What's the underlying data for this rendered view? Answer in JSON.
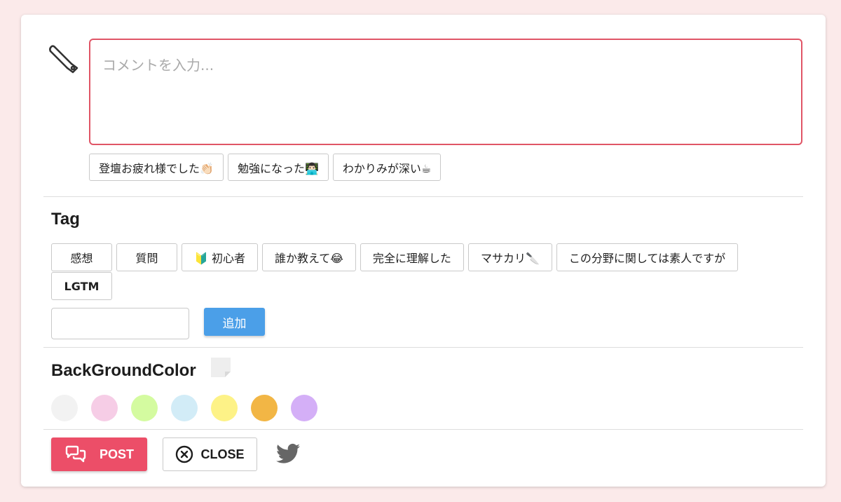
{
  "comment": {
    "placeholder": "コメントを入力..."
  },
  "quick_replies": [
    {
      "label": "登壇お疲れ様でした👏🏻"
    },
    {
      "label": "勉強になった👨🏻‍💻"
    },
    {
      "label": "わかりみが深い☕"
    }
  ],
  "tag_section": {
    "title": "Tag",
    "tags": [
      {
        "label": "感想"
      },
      {
        "label": "質問"
      },
      {
        "label": "🔰 初心者"
      },
      {
        "label": "誰か教えて😂"
      },
      {
        "label": "完全に理解した"
      },
      {
        "label": "マサカリ🔪"
      },
      {
        "label": "この分野に関しては素人ですが"
      },
      {
        "label": "LGTM"
      }
    ],
    "input_value": "",
    "add_label": "追加"
  },
  "background_section": {
    "title": "BackGroundColor",
    "colors": [
      "#f2f2f2",
      "#f6cde6",
      "#d4fba0",
      "#d2ecf7",
      "#fdf287",
      "#f2b645",
      "#d4aff7"
    ]
  },
  "actions": {
    "post_label": "POST",
    "close_label": "CLOSE"
  },
  "icons": {
    "tool": "saw-icon",
    "note": "sticky-note-icon",
    "post": "chat-bubbles-icon",
    "close": "close-circle-icon",
    "share": "twitter-icon"
  },
  "colors": {
    "accent": "#ec4e68",
    "primary": "#4b9fe8",
    "page_background": "#fbeaea"
  }
}
